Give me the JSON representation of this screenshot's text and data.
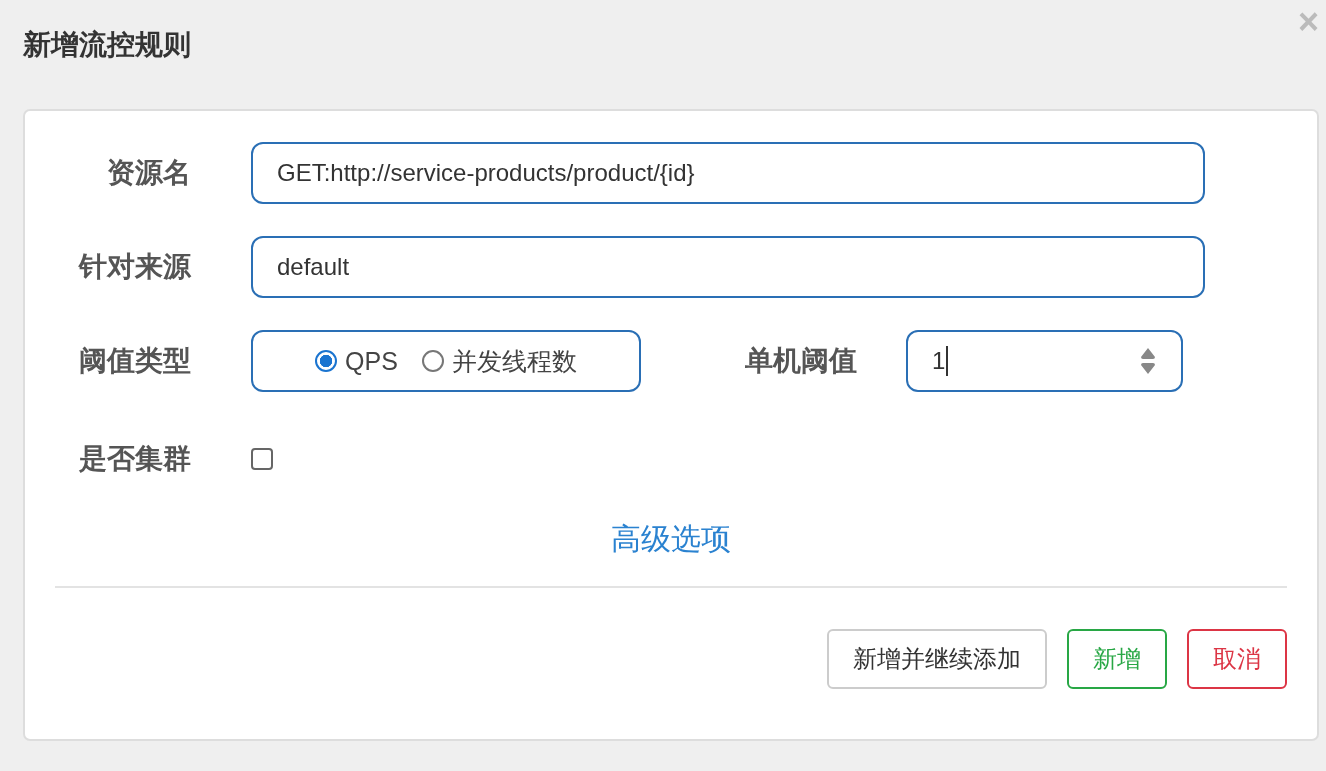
{
  "dialog": {
    "title": "新增流控规则",
    "close": "×"
  },
  "form": {
    "resource": {
      "label": "资源名",
      "value": "GET:http://service-products/product/{id}"
    },
    "origin": {
      "label": "针对来源",
      "value": "default"
    },
    "threshold_type": {
      "label": "阈值类型",
      "options": [
        {
          "label": "QPS",
          "selected": true
        },
        {
          "label": "并发线程数",
          "selected": false
        }
      ]
    },
    "threshold": {
      "label": "单机阈值",
      "value": "1"
    },
    "cluster": {
      "label": "是否集群",
      "checked": false
    },
    "advanced_link": "高级选项"
  },
  "buttons": [
    {
      "label": "新增并继续添加",
      "kind": "default"
    },
    {
      "label": "新增",
      "kind": "success"
    },
    {
      "label": "取消",
      "kind": "danger"
    }
  ]
}
